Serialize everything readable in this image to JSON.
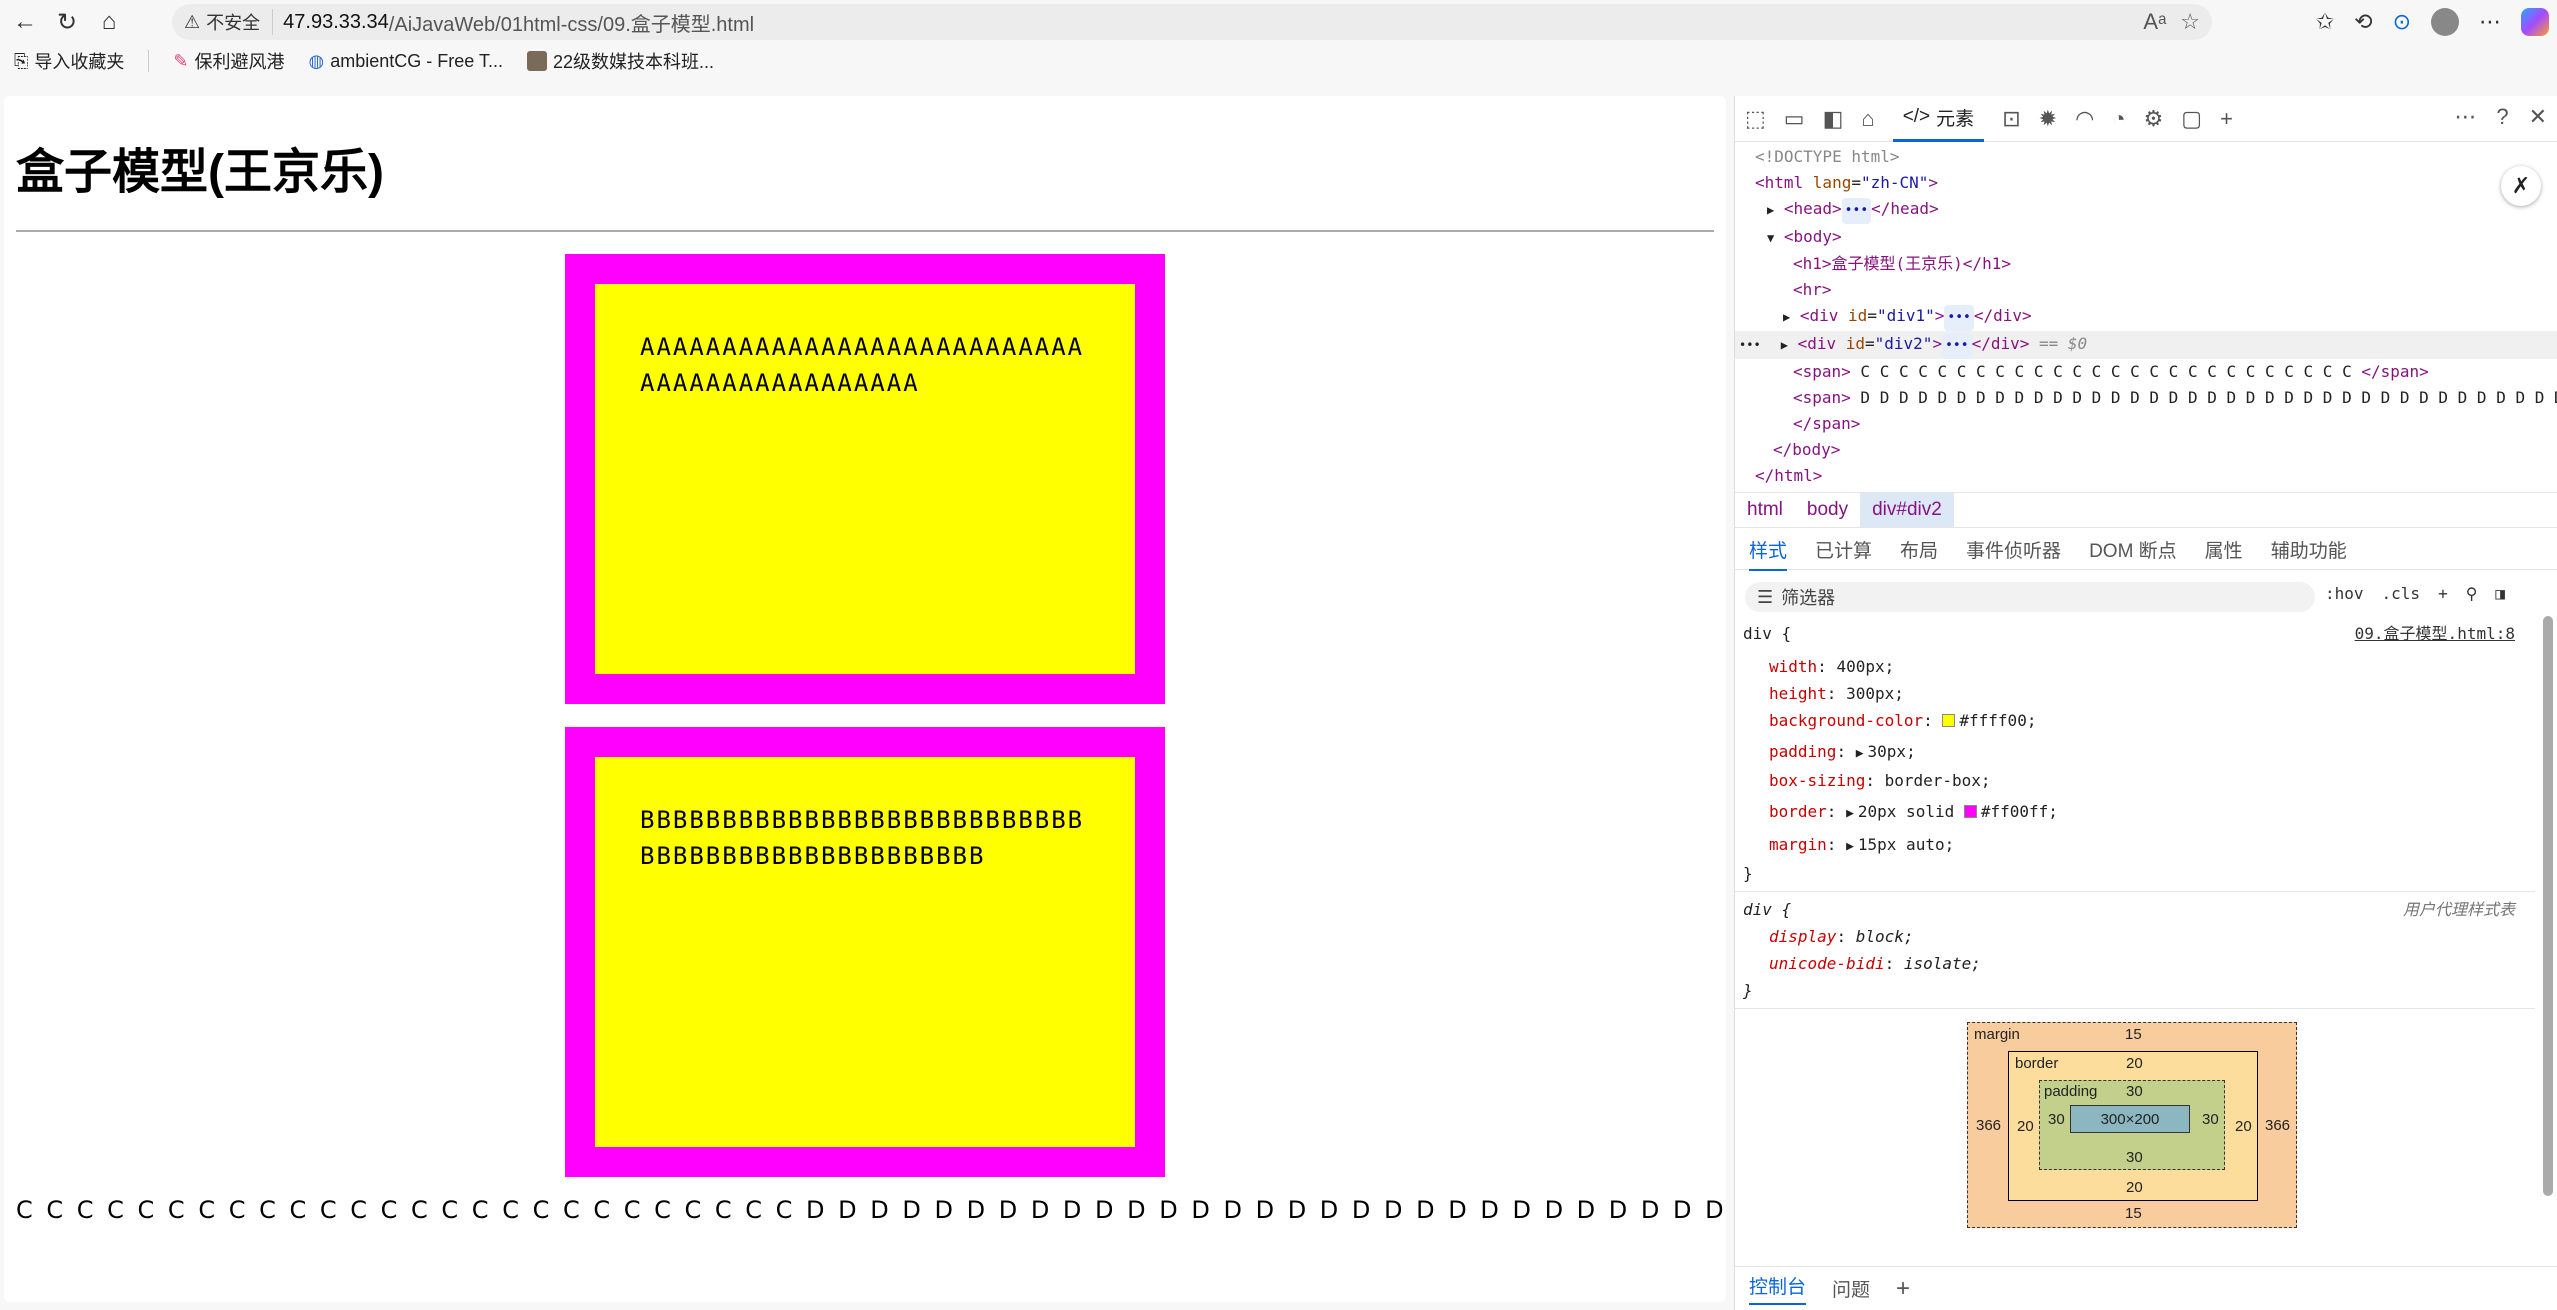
{
  "browser": {
    "insecure_label": "不安全",
    "url_host": "47.93.33.34",
    "url_path": "/AiJavaWeb/01html-css/09.盒子模型.html",
    "bookmarks": [
      "导入收藏夹",
      "保利避风港",
      "ambientCG - Free T...",
      "22级数媒技本科班..."
    ]
  },
  "page": {
    "title": "盒子模型(王京乐)",
    "div1_text": "AAAAAAAAAAAAAAAAAAAAAAAAAAAAAAAAAAAAAAAAAAAA",
    "div2_text": "BBBBBBBBBBBBBBBBBBBBBBBBBBBBBBBBBBBBBBBBBBBBBBBB",
    "spans_text": "C C C C C C C C C C C C C C C C C C C C C C C C C C D D D D D D D D D D D D D D D D D D D D D D D D D D D D D D D D D D D D D D"
  },
  "devtools": {
    "active_tab": "元素",
    "dom": {
      "doctype": "<!DOCTYPE html>",
      "html_open": "<html ",
      "lang_attr": "lang",
      "lang_val": "\"zh-CN\"",
      "head": "<head>",
      "head_close": "</head>",
      "body": "<body>",
      "h1": "<h1>盒子模型(王京乐)</h1>",
      "hr": "<hr>",
      "div_open": "<div ",
      "id_attr": "id",
      "div1_id": "\"div1\"",
      "div2_id": "\"div2\"",
      "div_close": "</div>",
      "selected_marker": "== $0",
      "span_open": "<span>",
      "span_close": "</span>",
      "span_c": " C C C C C C C C C C C C C C C C C C C C C C C C C C ",
      "span_d": " D D D D D D D D D D D D D D D D D D D D D D D D D D D D D D D D D D D D D D D",
      "body_close": "</body>",
      "html_close": "</html>",
      "ellipsis": "•••",
      "gutter": "•••"
    },
    "breadcrumb": [
      "html",
      "body",
      "div#div2"
    ],
    "subtabs": [
      "样式",
      "已计算",
      "布局",
      "事件侦听器",
      "DOM 断点",
      "属性",
      "辅助功能"
    ],
    "filter_placeholder": "筛选器",
    "filter_tools": [
      ":hov",
      ".cls"
    ],
    "rule1": {
      "selector": "div {",
      "source": "09.盒子模型.html:8",
      "props": [
        {
          "name": "width",
          "value": "400px;"
        },
        {
          "name": "height",
          "value": "300px;"
        },
        {
          "name": "background-color",
          "value": "#ffff00;",
          "swatch": "#ffff00"
        },
        {
          "name": "padding",
          "value": "30px;",
          "expand": true
        },
        {
          "name": "box-sizing",
          "value": "border-box;"
        },
        {
          "name": "border",
          "value": "20px solid",
          "swatch": "#ff00ff",
          "value2": "#ff00ff;",
          "expand": true
        },
        {
          "name": "margin",
          "value": "15px auto;",
          "expand": true
        }
      ],
      "close": "}"
    },
    "rule2": {
      "selector": "div {",
      "source": "用户代理样式表",
      "props": [
        {
          "name": "display",
          "value": "block;"
        },
        {
          "name": "unicode-bidi",
          "value": "isolate;"
        }
      ],
      "close": "}"
    },
    "box_model": {
      "margin_label": "margin",
      "border_label": "border",
      "padding_label": "padding",
      "margin_top": "15",
      "margin_bottom": "15",
      "margin_left": "366",
      "margin_right": "366",
      "border_top": "20",
      "border_bottom": "20",
      "border_left": "20",
      "border_right": "20",
      "padding_top": "30",
      "padding_bottom": "30",
      "padding_left": "30",
      "padding_right": "30",
      "content": "300×200"
    },
    "console_tabs": [
      "控制台",
      "问题"
    ]
  },
  "colors": {
    "box_bg": "#ffff00",
    "box_border": "#ff00ff",
    "accent": "#0a66d8"
  }
}
